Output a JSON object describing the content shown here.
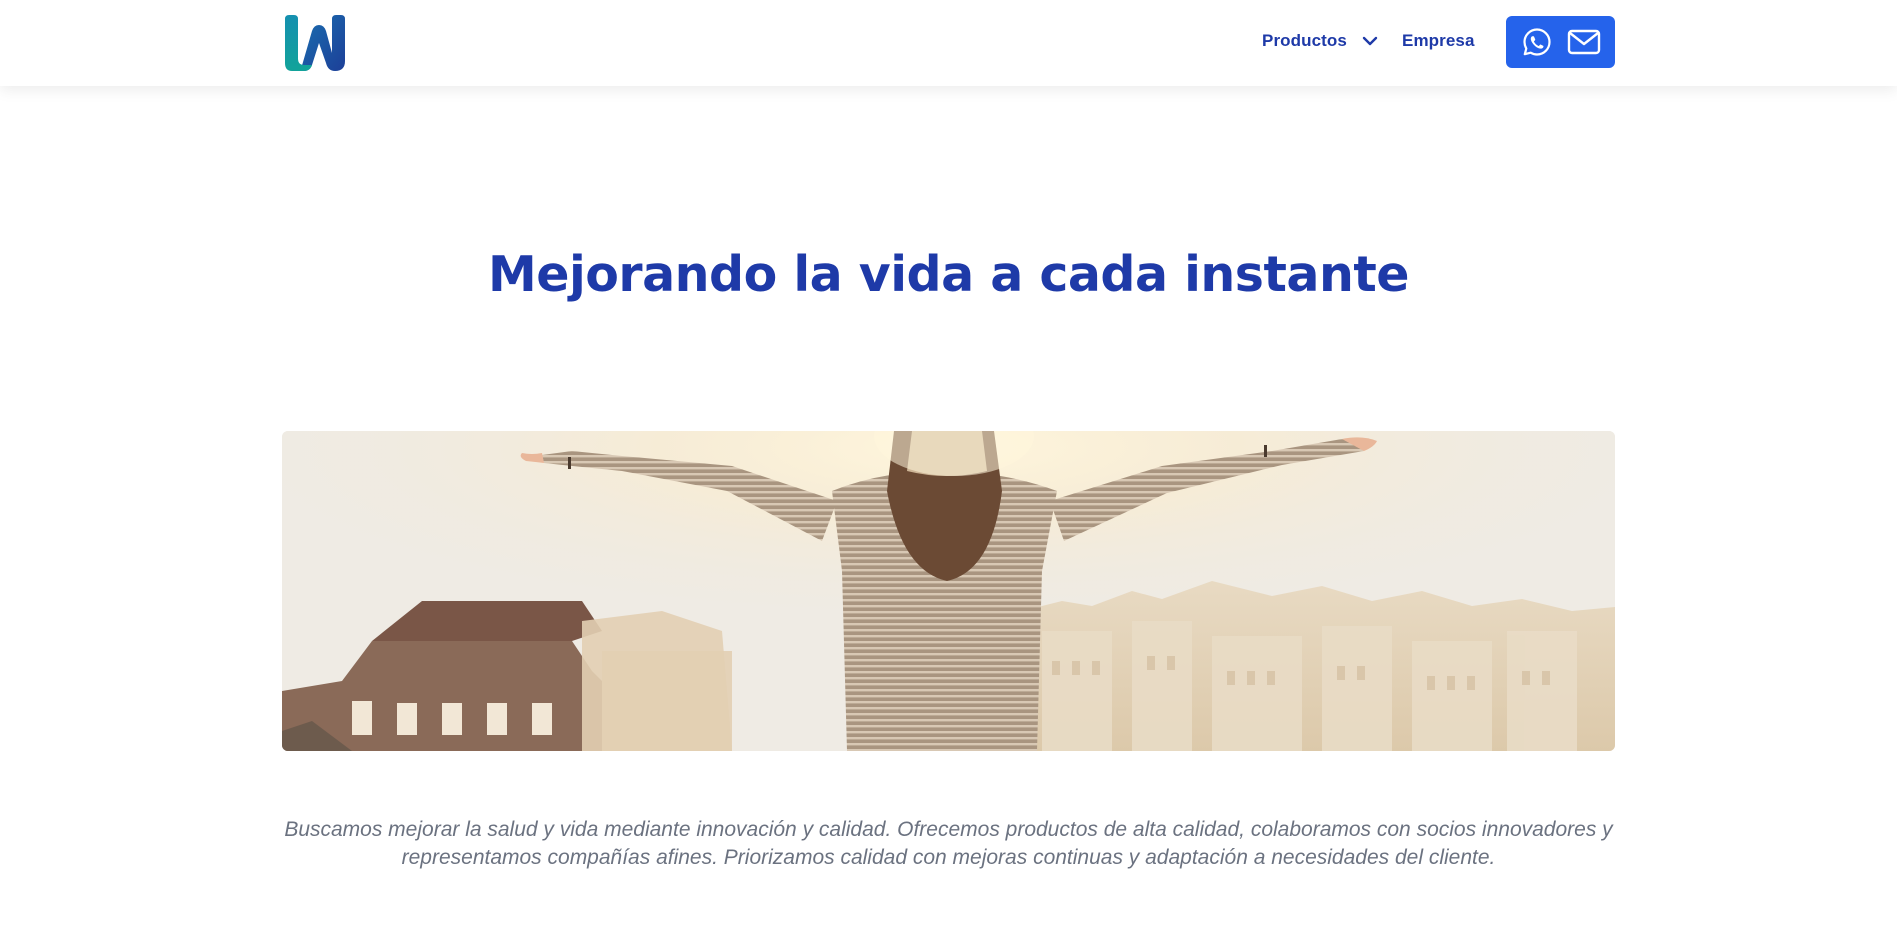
{
  "header": {
    "logo_icon": "brand-w-logo",
    "nav": {
      "products_label": "Productos",
      "products_icon": "chevron-down-icon",
      "company_label": "Empresa"
    },
    "contact": {
      "whatsapp_icon": "whatsapp-icon",
      "email_icon": "mail-icon"
    }
  },
  "hero": {
    "title": "Mejorando la vida a cada instante",
    "image_description_icon": "hero-photo",
    "description": "Buscamos mejorar la salud y vida mediante innovación y calidad. Ofrecemos productos de alta calidad, colaboramos con socios innovadores y representamos compañías afines. Priorizamos calidad con mejoras continuas y adaptación a necesidades del cliente."
  },
  "colors": {
    "brand_blue": "#1e3aa8",
    "button_blue": "#2563eb",
    "logo_teal": "#14a3a3",
    "logo_navy": "#1b4fa0",
    "text_gray": "#6b7280"
  }
}
